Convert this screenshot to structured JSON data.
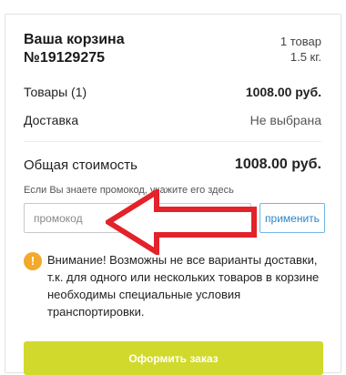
{
  "order": {
    "title_line1": "Ваша корзина",
    "title_line2": "№19129275",
    "item_count": "1 товар",
    "weight": "1.5 кг."
  },
  "summary": {
    "goods_label": "Товары (1)",
    "goods_value": "1008.00 руб.",
    "delivery_label": "Доставка",
    "delivery_value": "Не выбрана",
    "total_label": "Общая стоимость",
    "total_value": "1008.00 руб."
  },
  "promo": {
    "hint": "Если Вы знаете промокод, укажите его здесь",
    "placeholder": "промокод",
    "value": "",
    "apply_label": "применить"
  },
  "notice": {
    "icon": "exclamation-icon",
    "text": "Внимание! Возможны не все варианты доставки, т.к. для одного или нескольких товаров в корзине необходимы специальные условия транспортировки."
  },
  "checkout": {
    "label": "Оформить заказ"
  },
  "colors": {
    "arrow": "#e3222a",
    "accent_button": "#d1d92c",
    "link_blue": "#2a86c6",
    "warning": "#f3a92a"
  }
}
